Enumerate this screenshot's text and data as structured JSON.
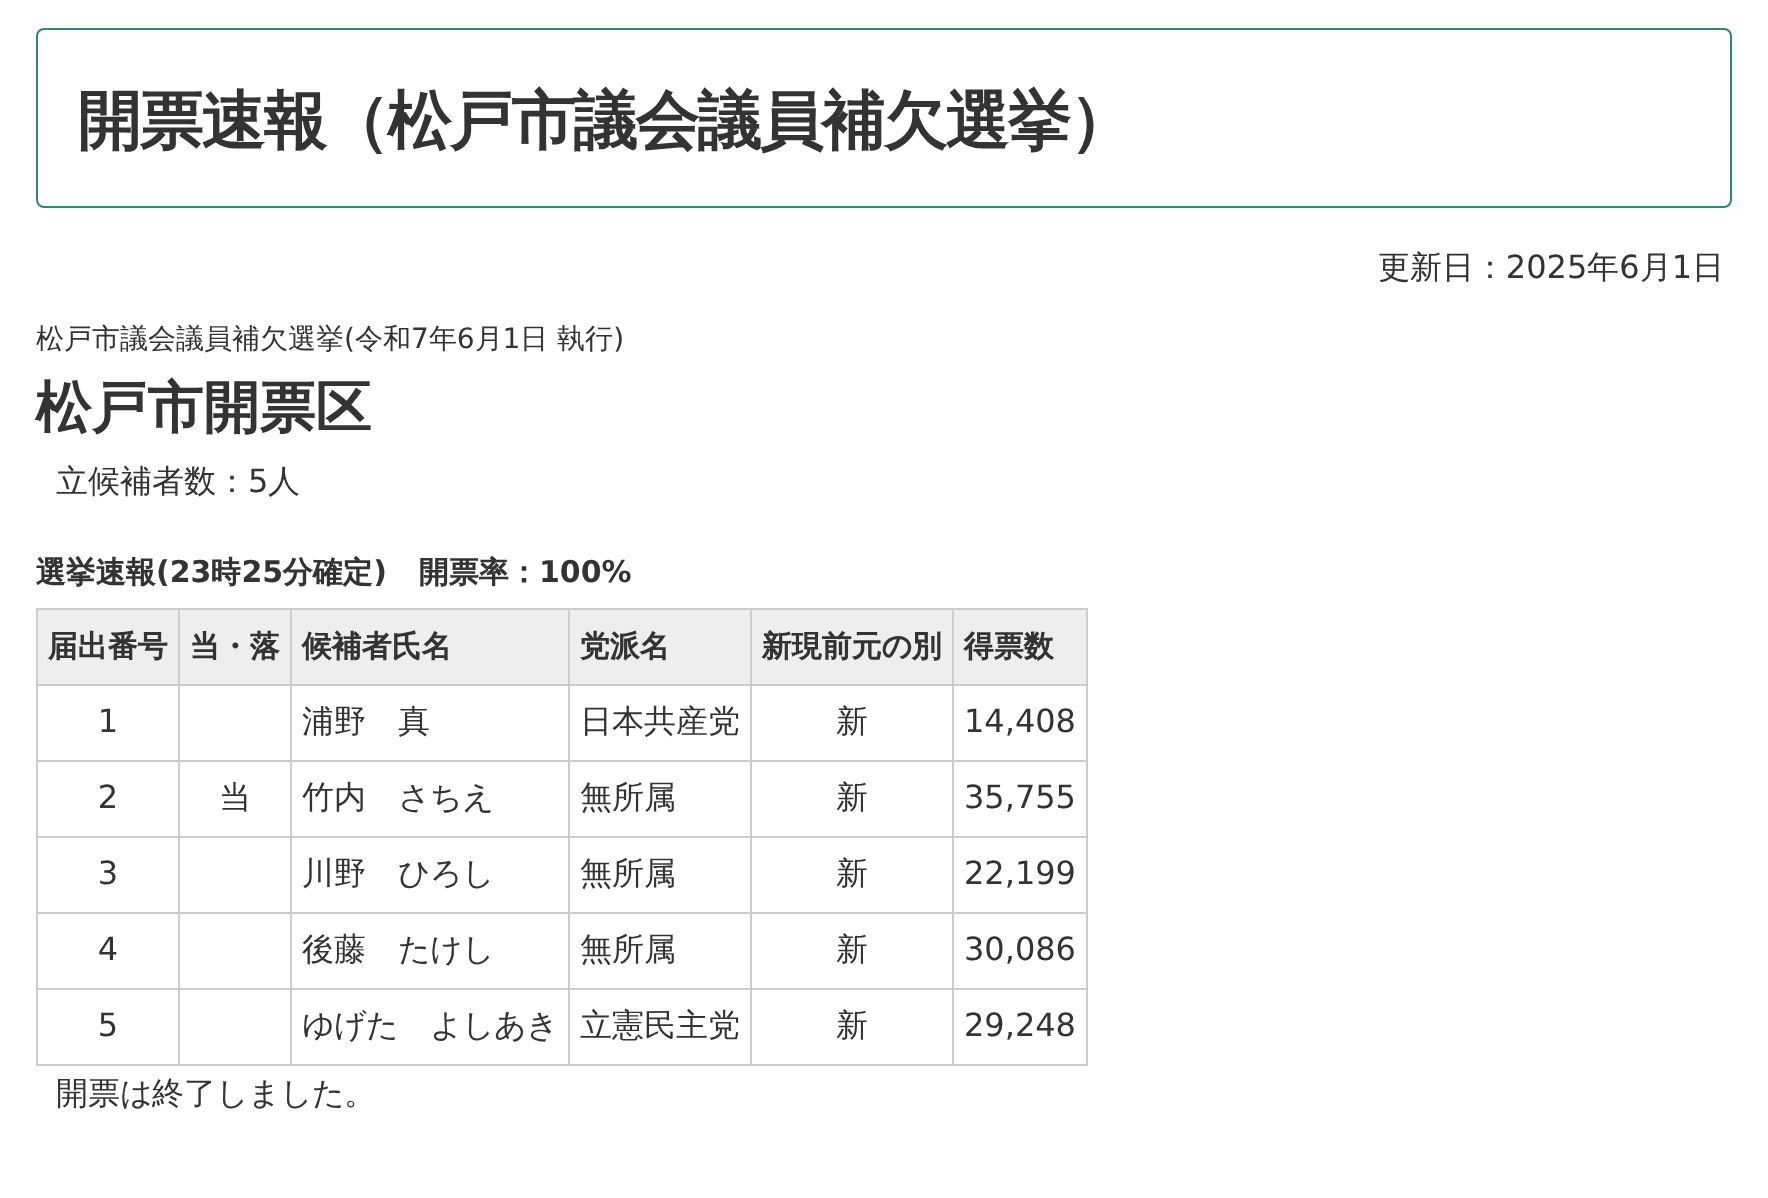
{
  "page_title": "開票速報（松戸市議会議員補欠選挙）",
  "updated": "更新日：2025年6月1日",
  "election": "松戸市議会議員補欠選挙(令和7年6月1日 執行)",
  "district": "松戸市開票区",
  "candidate_count": "立候補者数：5人",
  "report_status": "選挙速報(23時25分確定)",
  "counting_rate": "開票率：100%",
  "table": {
    "columns": [
      "届出番号",
      "当・落",
      "候補者氏名",
      "党派名",
      "新現前元の別",
      "得票数"
    ],
    "rows": [
      {
        "number": "1",
        "name": "浦野　真",
        "party": "日本共産党",
        "status": "新",
        "votes": "14,408"
      },
      {
        "number": "2",
        "result": "当",
        "name": "竹内　さちえ",
        "party": "無所属",
        "status": "新",
        "votes": "35,755"
      },
      {
        "number": "3",
        "name": "川野　ひろし",
        "party": "無所属",
        "status": "新",
        "votes": "22,199"
      },
      {
        "number": "4",
        "name": "後藤　たけし",
        "party": "無所属",
        "status": "新",
        "votes": "30,086"
      },
      {
        "number": "5",
        "name": "ゆげた　よしあき",
        "party": "立憲民主党",
        "status": "新",
        "votes": "29,248"
      }
    ]
  },
  "footer_note": "開票は終了しました。"
}
